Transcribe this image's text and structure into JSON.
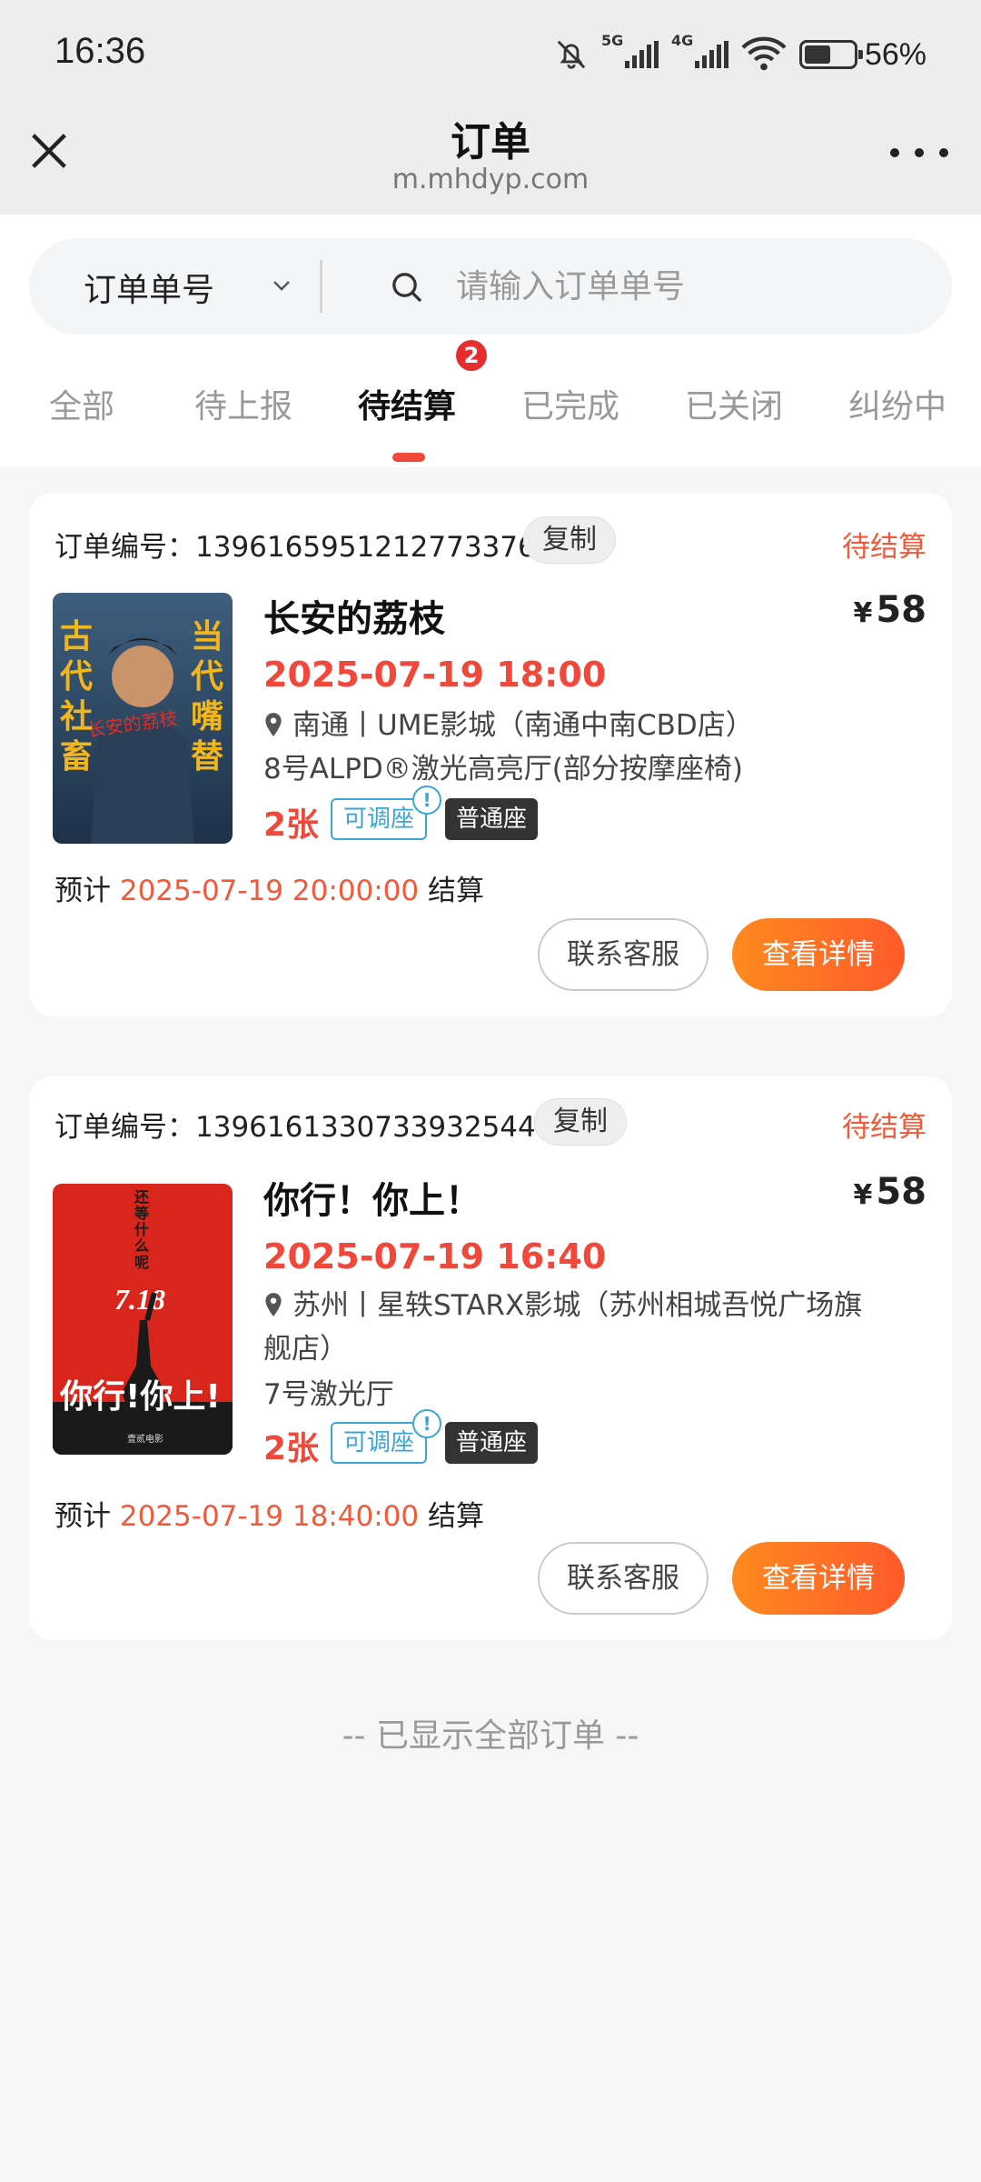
{
  "status_bar": {
    "time": "16:36",
    "net1": "5G",
    "net2": "4G",
    "battery": "56%"
  },
  "nav": {
    "title": "订单",
    "subtitle": "m.mhdyp.com"
  },
  "search": {
    "type_label": "订单单号",
    "placeholder": "请输入订单单号"
  },
  "tabs": [
    {
      "label": "全部"
    },
    {
      "label": "待上报"
    },
    {
      "label": "待结算",
      "badge": "2"
    },
    {
      "label": "已完成"
    },
    {
      "label": "已关闭"
    },
    {
      "label": "纠纷中"
    }
  ],
  "orders": [
    {
      "order_no_label": "订单编号：",
      "order_no": "1396165951212773376",
      "copy_label": "复制",
      "status": "待结算",
      "movie_title": "长安的荔枝",
      "price_symbol": "¥",
      "price": "58",
      "show_time": "2025-07-19 18:00",
      "cinema": "南通丨UME影城（南通中南CBD店）",
      "hall": "8号ALPD®激光高亮厅(部分按摩座椅)",
      "qty": "2张",
      "tag_adjust": "可调座",
      "tag_seat": "普通座",
      "settle_prefix": "预计",
      "settle_time": "2025-07-19 20:00:00",
      "settle_suffix": "结算",
      "btn_service": "联系客服",
      "btn_detail": "查看详情",
      "poster": {
        "left_text": "古代社畜",
        "right_text": "当代嘴替",
        "center_text": "长安的荔枝",
        "bg": "#2d4a66",
        "text_color": "#f2b61d"
      }
    },
    {
      "order_no_label": "订单编号：",
      "order_no": "1396161330733932544",
      "copy_label": "复制",
      "status": "待结算",
      "movie_title": "你行！你上！",
      "price_symbol": "¥",
      "price": "58",
      "show_time": "2025-07-19 16:40",
      "cinema": "苏州丨星轶STARX影城（苏州相城吾悦广场旗舰店）",
      "hall": "7号激光厅",
      "qty": "2张",
      "tag_adjust": "可调座",
      "tag_seat": "普通座",
      "settle_prefix": "预计",
      "settle_time": "2025-07-19 18:40:00",
      "settle_suffix": "结算",
      "btn_service": "联系客服",
      "btn_detail": "查看详情",
      "poster": {
        "top_text": "还等什么呢？",
        "date_text": "7.18",
        "bottom_text": "你行！你上！",
        "bg": "#d9261c",
        "text_color": "#ffffff"
      }
    }
  ],
  "footer": "-- 已显示全部订单 --",
  "colors": {
    "accent": "#f0493b",
    "status": "#f05a3a",
    "tag_blue": "#3ba7d6",
    "detail_gradient_start": "#ff8a1f",
    "detail_gradient_end": "#ff5a2a"
  }
}
